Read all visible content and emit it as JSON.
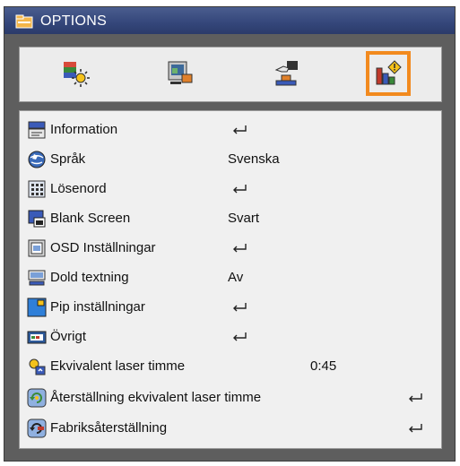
{
  "window": {
    "title": "OPTIONS",
    "title_icon": "options-folder-icon"
  },
  "tabs": [
    {
      "name": "image-settings-tab",
      "icon": "sun-picture-icon",
      "active": false
    },
    {
      "name": "display-settings-tab",
      "icon": "screen-picture-icon",
      "active": false
    },
    {
      "name": "setup-tab",
      "icon": "hand-setup-icon",
      "active": false
    },
    {
      "name": "options-tab",
      "icon": "bar-chart-info-icon",
      "active": true
    }
  ],
  "menu": {
    "items": [
      {
        "label": "Information",
        "value": "",
        "enter": "mid",
        "icon": "info-card-icon"
      },
      {
        "label": "Språk",
        "value": "Svenska",
        "enter": "",
        "icon": "globe-icon"
      },
      {
        "label": "Lösenord",
        "value": "",
        "enter": "mid",
        "icon": "password-keypad-icon"
      },
      {
        "label": "Blank Screen",
        "value": "Svart",
        "enter": "",
        "icon": "blank-screen-icon"
      },
      {
        "label": "OSD Inställningar",
        "value": "",
        "enter": "mid",
        "icon": "osd-settings-icon"
      },
      {
        "label": "Dold textning",
        "value": "Av",
        "enter": "",
        "icon": "closed-caption-icon"
      },
      {
        "label": "Pip inställningar",
        "value": "",
        "enter": "mid",
        "icon": "pip-icon"
      },
      {
        "label": "Övrigt",
        "value": "",
        "enter": "mid",
        "icon": "other-settings-icon"
      },
      {
        "label": "Ekvivalent laser timme",
        "value": "0:45",
        "enter": "",
        "icon": "laser-hour-icon"
      },
      {
        "label": "Återställning ekvivalent laser timme",
        "value": "",
        "enter": "right",
        "icon": "reset-laser-icon"
      },
      {
        "label": "Fabriksåterställning",
        "value": "",
        "enter": "right",
        "icon": "factory-reset-icon"
      }
    ]
  },
  "colors": {
    "frame": "#5e5e5e",
    "title_bar": "#34467a",
    "panel": "#f0f0f0",
    "active_tab_border": "#f28a1e",
    "text": "#111111"
  }
}
